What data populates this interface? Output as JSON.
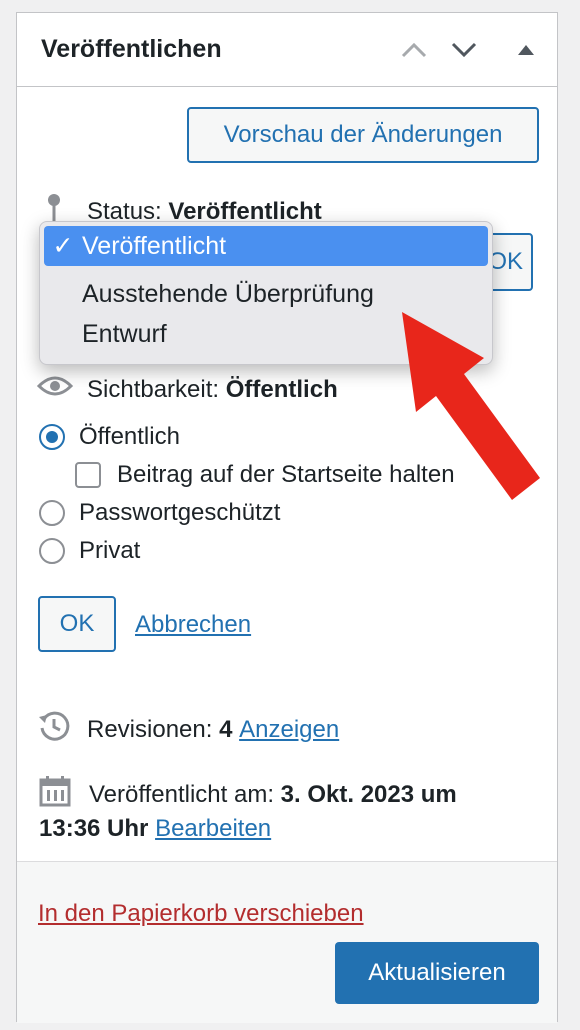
{
  "panel": {
    "title": "Veröffentlichen",
    "preview_button": "Vorschau der Änderungen"
  },
  "status": {
    "label": "Status:",
    "value": "Veröffentlicht",
    "ok_label": "OK",
    "dropdown": {
      "check": "✓",
      "options": [
        "Veröffentlicht",
        "Ausstehende Überprüfung",
        "Entwurf"
      ],
      "selected": "Veröffentlicht"
    }
  },
  "visibility": {
    "label": "Sichtbarkeit:",
    "value": "Öffentlich",
    "options": {
      "public": "Öffentlich",
      "sticky": "Beitrag auf der Startseite halten",
      "password": "Passwortgeschützt",
      "private": "Privat"
    },
    "ok_label": "OK",
    "cancel_label": "Abbrechen"
  },
  "revisions": {
    "label": "Revisionen:",
    "count": "4",
    "link": "Anzeigen"
  },
  "published": {
    "label": "Veröffentlicht am:",
    "date_part1": "3. Okt. 2023 um",
    "date_part2": "13:36 Uhr",
    "edit_link": "Bearbeiten"
  },
  "footer": {
    "trash_link": "In den Papierkorb verschieben",
    "update_button": "Aktualisieren"
  },
  "colors": {
    "accent": "#2271b1",
    "danger": "#b32d2e",
    "annotation_arrow": "#e8261b"
  }
}
